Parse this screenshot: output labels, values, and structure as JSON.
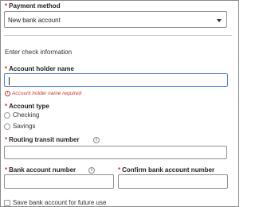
{
  "payment_method": {
    "label": "Payment method",
    "required_mark": "*",
    "selected": "New bank account",
    "dropdown_icon": "chevron-down-icon"
  },
  "check_info": {
    "heading": "Enter check information"
  },
  "account_holder": {
    "label": "Account holder name",
    "required_mark": "*",
    "value": "",
    "error": "Account holder name required",
    "error_icon": "!"
  },
  "account_type": {
    "label": "Account type",
    "required_mark": "*",
    "options": [
      "Checking",
      "Savings"
    ]
  },
  "routing": {
    "label": "Routing transit number",
    "required_mark": "*",
    "info_icon": "i",
    "value": ""
  },
  "bank_account": {
    "label": "Bank account number",
    "required_mark": "*",
    "info_icon": "i",
    "value": ""
  },
  "confirm_account": {
    "label": "Confirm bank account number",
    "required_mark": "*",
    "value": ""
  },
  "save_account": {
    "label": "Save bank account for future use",
    "checked": false
  },
  "colors": {
    "required": "#c0392b",
    "error": "#c0392b",
    "focus": "#4a7fd4",
    "border": "#8f8f8f"
  }
}
